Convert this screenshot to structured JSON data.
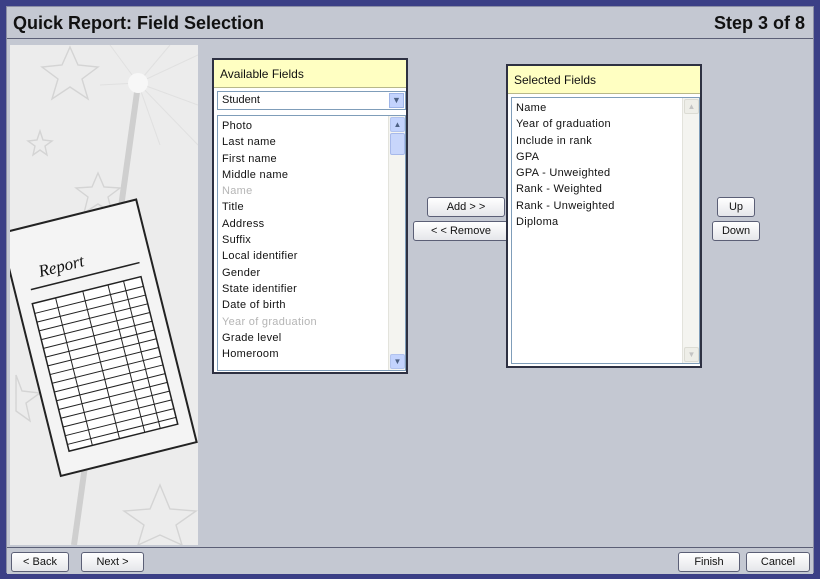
{
  "header": {
    "title": "Quick Report: Field Selection",
    "step": "Step 3 of 8"
  },
  "illustration": {
    "label": "Report"
  },
  "available": {
    "header": "Available Fields",
    "selected_category": "Student",
    "items": [
      {
        "label": "Photo",
        "enabled": true
      },
      {
        "label": "Last name",
        "enabled": true
      },
      {
        "label": "First name",
        "enabled": true
      },
      {
        "label": "Middle name",
        "enabled": true
      },
      {
        "label": "Name",
        "enabled": false
      },
      {
        "label": "Title",
        "enabled": true
      },
      {
        "label": "Address",
        "enabled": true
      },
      {
        "label": "Suffix",
        "enabled": true
      },
      {
        "label": "Local identifier",
        "enabled": true
      },
      {
        "label": "Gender",
        "enabled": true
      },
      {
        "label": "State identifier",
        "enabled": true
      },
      {
        "label": "Date of birth",
        "enabled": true
      },
      {
        "label": "Year of graduation",
        "enabled": false
      },
      {
        "label": "Grade level",
        "enabled": true
      },
      {
        "label": "Homeroom",
        "enabled": true
      }
    ]
  },
  "selected": {
    "header": "Selected Fields",
    "items": [
      {
        "label": "Name"
      },
      {
        "label": "Year of graduation"
      },
      {
        "label": "Include in rank"
      },
      {
        "label": "GPA"
      },
      {
        "label": "GPA - Unweighted"
      },
      {
        "label": "Rank - Weighted"
      },
      {
        "label": "Rank - Unweighted"
      },
      {
        "label": "Diploma"
      }
    ]
  },
  "buttons": {
    "add": "Add > >",
    "remove": "< < Remove",
    "up": "Up",
    "down": "Down",
    "back": "< Back",
    "next": "Next >",
    "finish": "Finish",
    "cancel": "Cancel"
  },
  "colors": {
    "background": "#3b3f86",
    "window": "#c4c8d2",
    "panel_header": "#ffffc2",
    "disabled_text": "#b5b5b5"
  }
}
